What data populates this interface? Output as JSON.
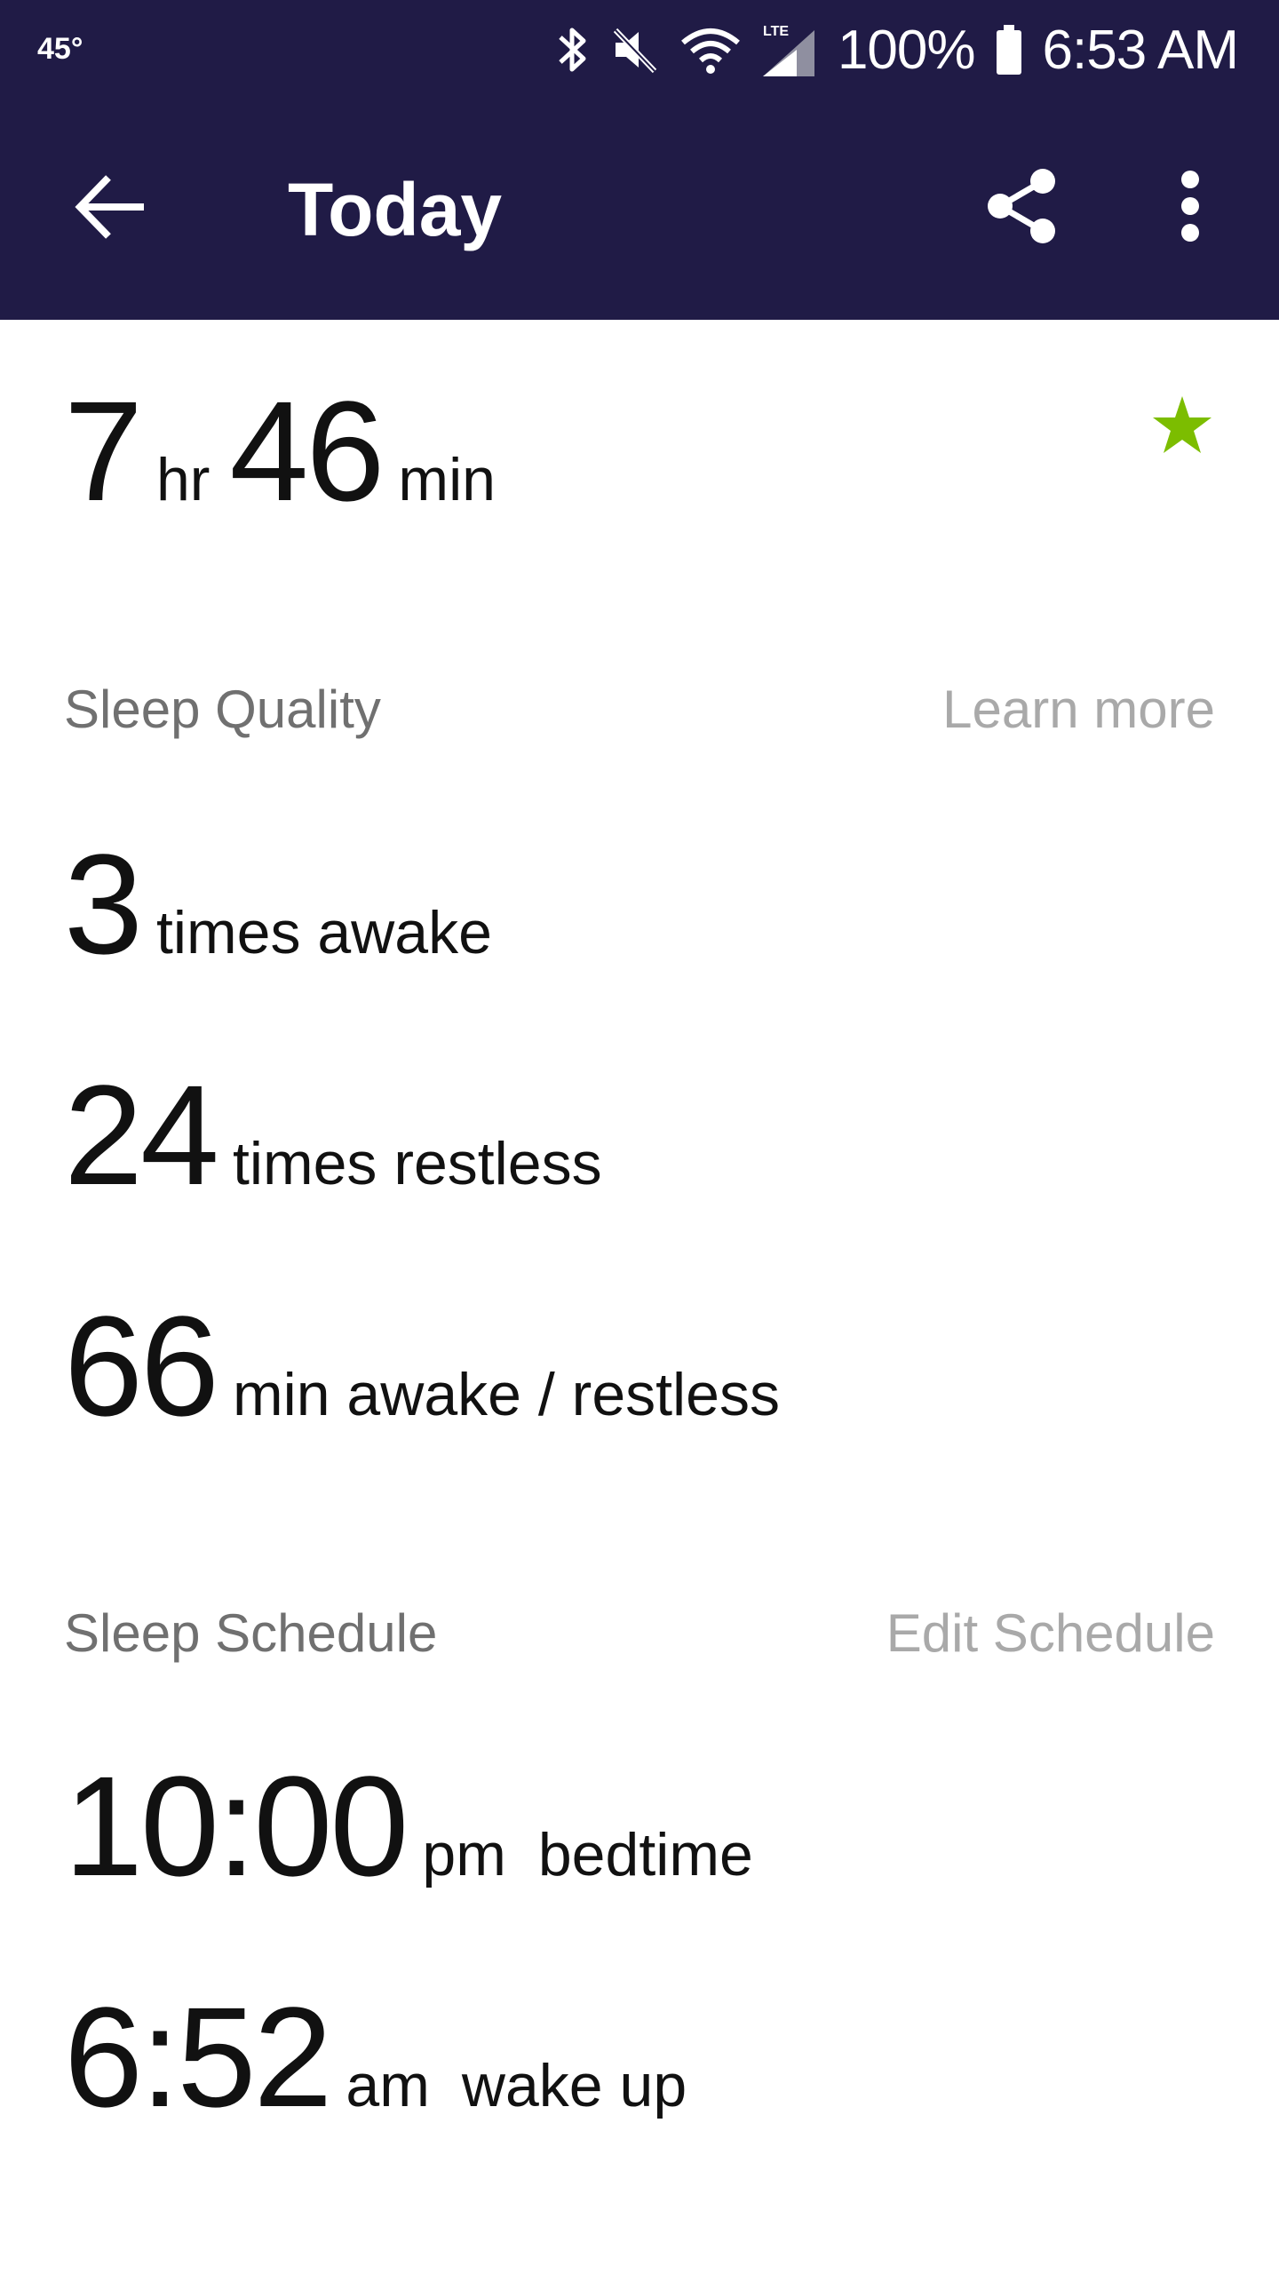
{
  "status_bar": {
    "temperature": "45°",
    "battery": "100%",
    "time": "6:53 AM",
    "icons": [
      "bluetooth-icon",
      "mute-icon",
      "wifi-icon",
      "lte-signal-icon",
      "battery-icon"
    ]
  },
  "toolbar": {
    "title": "Today",
    "back_icon": "arrow-back-icon",
    "share_icon": "share-icon",
    "overflow_icon": "more-vert-icon"
  },
  "summary": {
    "hours": "7",
    "hours_unit": "hr",
    "minutes": "46",
    "minutes_unit": "min",
    "goal_icon": "star-icon",
    "goal_color": "#7cbd00"
  },
  "sleep_quality": {
    "title": "Sleep Quality",
    "link": "Learn more",
    "stats": [
      {
        "value": "3",
        "label": "times awake"
      },
      {
        "value": "24",
        "label": "times restless"
      },
      {
        "value": "66",
        "label": "min awake / restless"
      }
    ]
  },
  "sleep_schedule": {
    "title": "Sleep Schedule",
    "link": "Edit Schedule",
    "items": [
      {
        "time": "10:00",
        "period": "pm",
        "label": "bedtime"
      },
      {
        "time": "6:52",
        "period": "am",
        "label": "wake up"
      }
    ]
  },
  "colors": {
    "header_bg": "#201b46",
    "accent_green": "#7cbd00",
    "section_title": "#707070",
    "link": "#a9a9a9"
  }
}
